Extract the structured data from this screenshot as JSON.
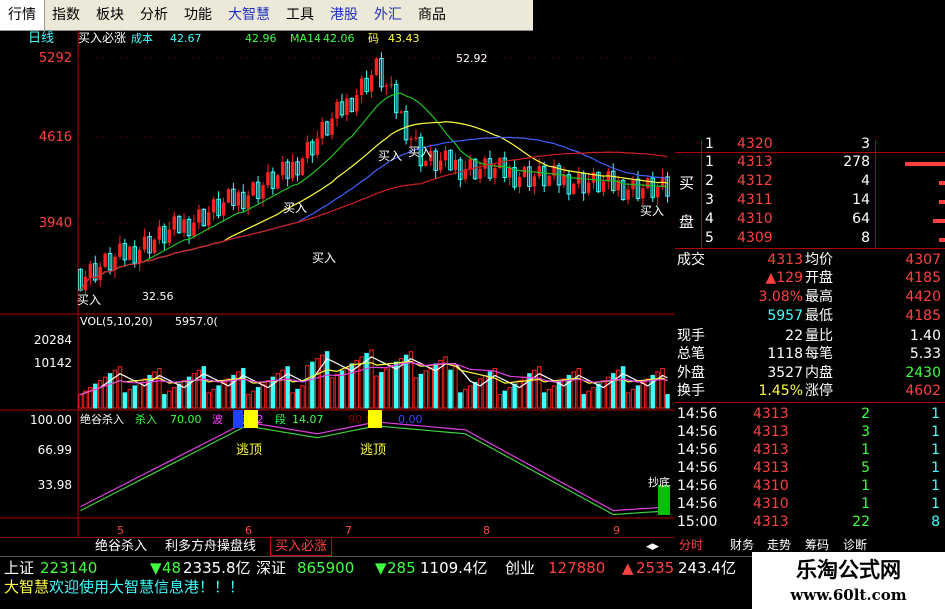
{
  "menu": [
    "行情",
    "指数",
    "板块",
    "分析",
    "功能",
    "大智慧",
    "工具",
    "港股",
    "外汇",
    "商品"
  ],
  "chart_header": {
    "period": "日线",
    "formula": "买入必涨",
    "cost_label": "成本",
    "cost_value": "42.67",
    "ma1_label": "",
    "ma1_value": "42.96",
    "ma14_label": "MA14",
    "ma14_value": "42.06",
    "tail_label": "码",
    "tail_value": "43.43"
  },
  "price_axis": [
    "5292",
    "4616",
    "3940"
  ],
  "price_annotations": {
    "high": "52.92",
    "low": "32.56"
  },
  "buy_signal": "买入",
  "vol_header": {
    "label": "VOL(5,10,20)",
    "value": "5957.0("
  },
  "vol_axis": [
    "20284",
    "10142"
  ],
  "ind_header": {
    "name": "绝谷杀入",
    "l1": "杀入",
    "v1": "70.00",
    "l2": "波",
    "v2": "15.92",
    "l3": "段",
    "v3": "14.07",
    "v4": "90.00",
    "v5": "0.00"
  },
  "ind_axis": [
    "100.00",
    "66.99",
    "33.98"
  ],
  "escape_label": "逃顶",
  "bottom_signal": "抄底",
  "x_axis": [
    "5",
    "6",
    "7",
    "8",
    "9"
  ],
  "formula_tabs": [
    "绝谷杀入",
    "利多方舟操盘线",
    "买入必涨"
  ],
  "right_tabs": [
    "分时",
    "财务",
    "走势",
    "筹码",
    "诊断"
  ],
  "orderbook": {
    "buy_label": "买",
    "disk_label": "盘",
    "rows": [
      {
        "lvl": "1",
        "price": "4320",
        "vol": "3"
      },
      {
        "lvl": "1",
        "price": "4313",
        "vol": "278"
      },
      {
        "lvl": "2",
        "price": "4312",
        "vol": "4"
      },
      {
        "lvl": "3",
        "price": "4311",
        "vol": "14"
      },
      {
        "lvl": "4",
        "price": "4310",
        "vol": "64"
      },
      {
        "lvl": "5",
        "price": "4309",
        "vol": "8"
      }
    ]
  },
  "stats": [
    {
      "l": "成交",
      "v": "4313",
      "l2": "均价",
      "v2": "4307"
    },
    {
      "l": "",
      "v": "▲129",
      "l2": "开盘",
      "v2": "4185"
    },
    {
      "l": "",
      "v": "3.08%",
      "l2": "最高",
      "v2": "4420"
    },
    {
      "l": "",
      "v": "5957",
      "l2": "最低",
      "v2": "4185"
    },
    {
      "l": "现手",
      "v": "22",
      "l2": "量比",
      "v2": "1.40"
    },
    {
      "l": "总笔",
      "v": "1118",
      "l2": "每笔",
      "v2": "5.33"
    },
    {
      "l": "外盘",
      "v": "3527",
      "l2": "内盘",
      "v2": "2430"
    },
    {
      "l": "换手",
      "v": "1.45%",
      "l2": "涨停",
      "v2": "4602"
    }
  ],
  "ticks": [
    {
      "t": "14:56",
      "p": "4313",
      "v": "2",
      "n": "1"
    },
    {
      "t": "14:56",
      "p": "4313",
      "v": "3",
      "n": "1"
    },
    {
      "t": "14:56",
      "p": "4313",
      "v": "1",
      "n": "1"
    },
    {
      "t": "14:56",
      "p": "4313",
      "v": "5",
      "n": "1"
    },
    {
      "t": "14:56",
      "p": "4310",
      "v": "1",
      "n": "1"
    },
    {
      "t": "14:56",
      "p": "4310",
      "v": "1",
      "n": "1"
    },
    {
      "t": "15:00",
      "p": "4313",
      "v": "22",
      "n": "8"
    }
  ],
  "status": {
    "sh_label": "上证",
    "sh_value": "223140",
    "sh_arrow": "▼",
    "sh_change": "48",
    "sh_amt": "2335.8亿",
    "sz_label": "深证",
    "sz_value": "865900",
    "sz_arrow": "▼",
    "sz_change": "285",
    "sz_amt": "1109.4亿",
    "cy_label": "创业",
    "cy_value": "127880",
    "cy_arrow": "▲",
    "cy_change": "2535",
    "cy_amt": "243.4亿"
  },
  "ticker": {
    "brand": "大智慧",
    "text": "欢迎使用大智慧信息港！！！"
  },
  "logo": {
    "line1": "乐淘公式网",
    "line2": "www.60lt.com"
  },
  "colors": {
    "up": "#ff2020",
    "down": "#40ffff",
    "ma_yellow": "#ffff40",
    "ma_green": "#20c020",
    "ma_blue": "#4060ff",
    "ma_red": "#d02020",
    "ind_pink": "#e040e0",
    "ind_green": "#40d040"
  }
}
